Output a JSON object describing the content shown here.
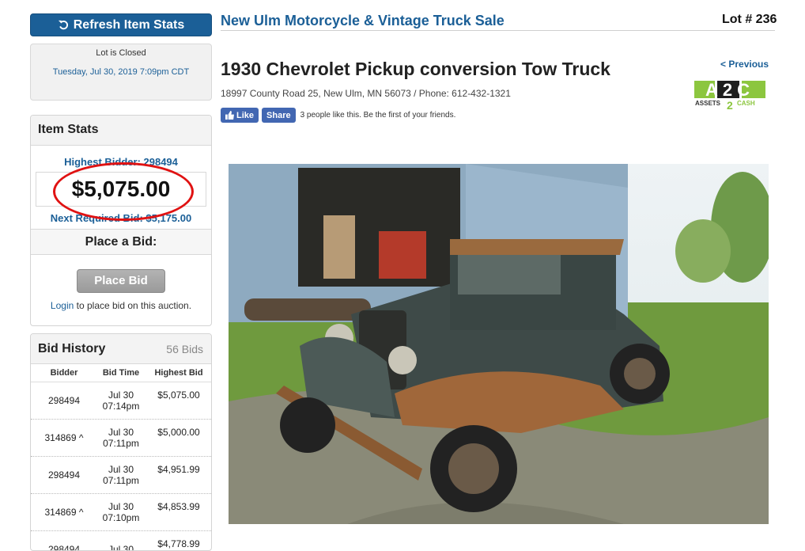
{
  "left": {
    "refresh_label": "Refresh Item Stats",
    "status": "Lot is Closed",
    "closed_date": "Tuesday, Jul 30, 2019 7:09pm CDT",
    "stats": {
      "heading": "Item Stats",
      "highest_bidder": "Highest Bidder: 298494",
      "price": "$5,075.00",
      "next_bid": "Next Required Bid: $5,175.00",
      "place_heading": "Place a Bid:",
      "place_button": "Place Bid",
      "login_link": "Login",
      "login_rest": " to place bid on this auction."
    },
    "history": {
      "heading": "Bid History",
      "count": "56 Bids",
      "columns": [
        "Bidder",
        "Bid Time",
        "Highest Bid"
      ],
      "rows": [
        {
          "bidder": "298494",
          "date": "Jul 30",
          "time": "07:14pm",
          "amount": "$5,075.00"
        },
        {
          "bidder": "314869 ^",
          "date": "Jul 30",
          "time": "07:11pm",
          "amount": "$5,000.00"
        },
        {
          "bidder": "298494",
          "date": "Jul 30",
          "time": "07:11pm",
          "amount": "$4,951.99"
        },
        {
          "bidder": "314869 ^",
          "date": "Jul 30",
          "time": "07:10pm",
          "amount": "$4,853.99"
        },
        {
          "bidder": "298494",
          "date": "Jul 30",
          "time": "",
          "amount": "$4,778.99"
        }
      ]
    }
  },
  "header": {
    "sale_title": "New Ulm Motorcycle & Vintage Truck Sale",
    "lot": "Lot # 236",
    "item_title": "1930 Chevrolet Pickup conversion Tow Truck",
    "previous": "< Previous",
    "address": "18997 County Road 25, New Ulm, MN 56073 / Phone: 612-432-1321"
  },
  "social": {
    "like": "Like",
    "share": "Share",
    "text": "3 people like this. Be the first of your friends."
  },
  "logo": {
    "line1": "A2C",
    "line2": "ASSETS",
    "num": "2",
    "line3": "CASH"
  },
  "colors": {
    "accent": "#1b5f97",
    "highlight": "#e01212",
    "facebook": "#4267b2"
  }
}
